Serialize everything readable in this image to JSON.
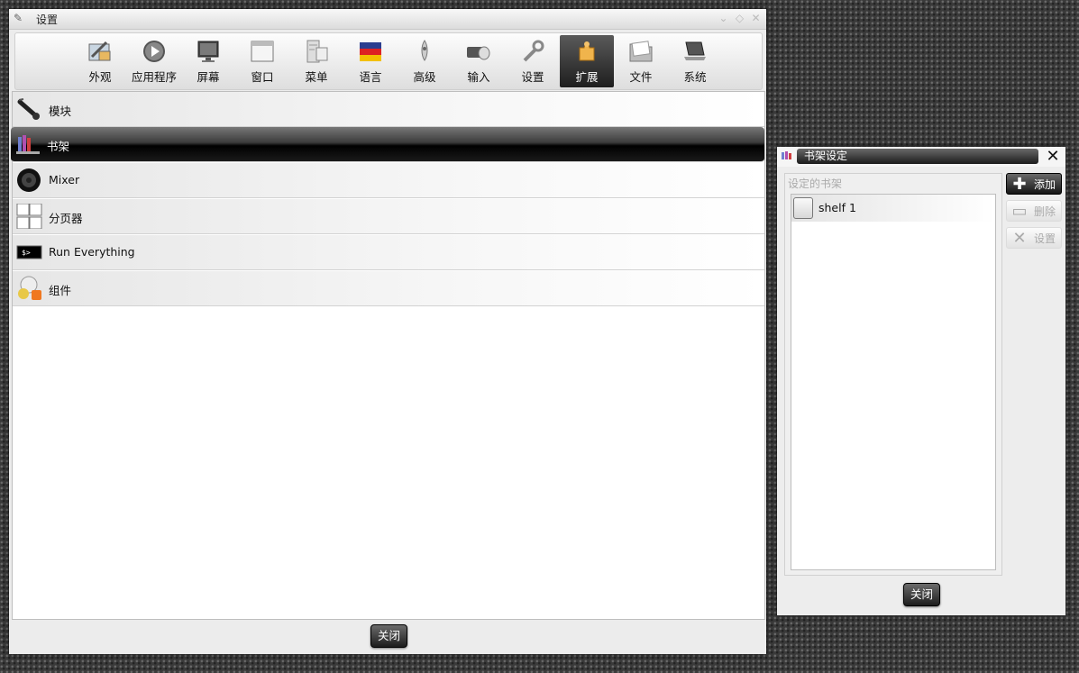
{
  "main_window": {
    "title": "设置",
    "toolbar": [
      {
        "label": "外观",
        "icon": "appearance-icon"
      },
      {
        "label": "应用程序",
        "icon": "applications-icon"
      },
      {
        "label": "屏幕",
        "icon": "screen-icon"
      },
      {
        "label": "窗口",
        "icon": "window-icon"
      },
      {
        "label": "菜单",
        "icon": "menu-icon"
      },
      {
        "label": "语言",
        "icon": "language-icon"
      },
      {
        "label": "高级",
        "icon": "advanced-icon"
      },
      {
        "label": "输入",
        "icon": "input-icon"
      },
      {
        "label": "设置",
        "icon": "settings-icon"
      },
      {
        "label": "扩展",
        "icon": "extensions-icon",
        "active": true
      },
      {
        "label": "文件",
        "icon": "files-icon"
      },
      {
        "label": "系统",
        "icon": "system-icon"
      }
    ],
    "list": [
      {
        "label": "模块",
        "icon": "module-plug-icon"
      },
      {
        "label": "书架",
        "icon": "shelf-books-icon",
        "selected": true
      },
      {
        "label": "Mixer",
        "icon": "speaker-icon"
      },
      {
        "label": "分页器",
        "icon": "pager-icon"
      },
      {
        "label": "Run Everything",
        "icon": "terminal-icon"
      },
      {
        "label": "组件",
        "icon": "widgets-icon"
      }
    ],
    "close_label": "关闭"
  },
  "shelf_dialog": {
    "title": "书架设定",
    "group_label": "设定的书架",
    "shelves": [
      {
        "label": "shelf 1"
      }
    ],
    "buttons": {
      "add": "添加",
      "delete": "删除",
      "settings": "设置"
    },
    "close_label": "关闭"
  },
  "colors": {
    "selected_row": "#111111",
    "window_bg": "#ececec",
    "desktop": "#3a3a3a"
  }
}
